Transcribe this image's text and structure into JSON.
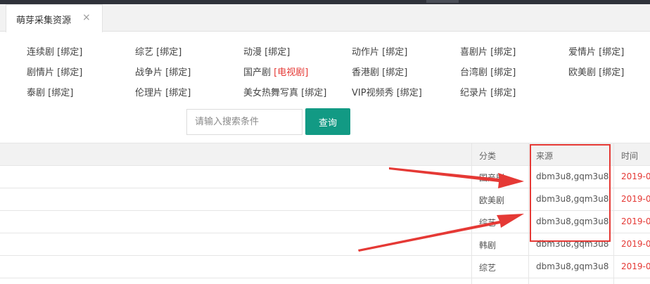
{
  "tab": {
    "title": "萌芽采集资源",
    "close": "×"
  },
  "categories": [
    {
      "name": "连续剧",
      "bind": "[绑定]",
      "bind_color": "default"
    },
    {
      "name": "综艺",
      "bind": "[绑定]",
      "bind_color": "default"
    },
    {
      "name": "动漫",
      "bind": "[绑定]",
      "bind_color": "default"
    },
    {
      "name": "动作片",
      "bind": "[绑定]",
      "bind_color": "default"
    },
    {
      "name": "喜剧片",
      "bind": "[绑定]",
      "bind_color": "default"
    },
    {
      "name": "爱情片",
      "bind": "[绑定]",
      "bind_color": "default"
    },
    {
      "name": "剧情片",
      "bind": "[绑定]",
      "bind_color": "default"
    },
    {
      "name": "战争片",
      "bind": "[绑定]",
      "bind_color": "default"
    },
    {
      "name": "国产剧",
      "bind": "[电视剧]",
      "bind_color": "#e53935"
    },
    {
      "name": "香港剧",
      "bind": "[绑定]",
      "bind_color": "default"
    },
    {
      "name": "台湾剧",
      "bind": "[绑定]",
      "bind_color": "default"
    },
    {
      "name": "欧美剧",
      "bind": "[绑定]",
      "bind_color": "default"
    },
    {
      "name": "泰剧",
      "bind": "[绑定]",
      "bind_color": "default"
    },
    {
      "name": "伦理片",
      "bind": "[绑定]",
      "bind_color": "default"
    },
    {
      "name": "美女热舞写真",
      "bind": "[绑定]",
      "bind_color": "default"
    },
    {
      "name": "VIP视频秀",
      "bind": "[绑定]",
      "bind_color": "default"
    },
    {
      "name": "纪录片",
      "bind": "[绑定]",
      "bind_color": "default"
    }
  ],
  "search": {
    "placeholder": "请输入搜索条件",
    "button": "查询"
  },
  "table": {
    "headers": {
      "category": "分类",
      "source": "来源",
      "time": "时间"
    },
    "rows": [
      {
        "category": "国产剧",
        "source": "dbm3u8,gqm3u8",
        "time": "2019-0"
      },
      {
        "category": "欧美剧",
        "source": "dbm3u8,gqm3u8",
        "time": "2019-0"
      },
      {
        "category": "综艺",
        "source": "dbm3u8,gqm3u8",
        "time": "2019-0"
      },
      {
        "category": "韩剧",
        "source": "dbm3u8,gqm3u8",
        "time": "2019-0"
      },
      {
        "category": "综艺",
        "source": "dbm3u8,gqm3u8",
        "time": "2019-0"
      }
    ]
  },
  "colors": {
    "accent": "#129a84",
    "annotation": "#e53935",
    "time_text": "#e53935"
  }
}
